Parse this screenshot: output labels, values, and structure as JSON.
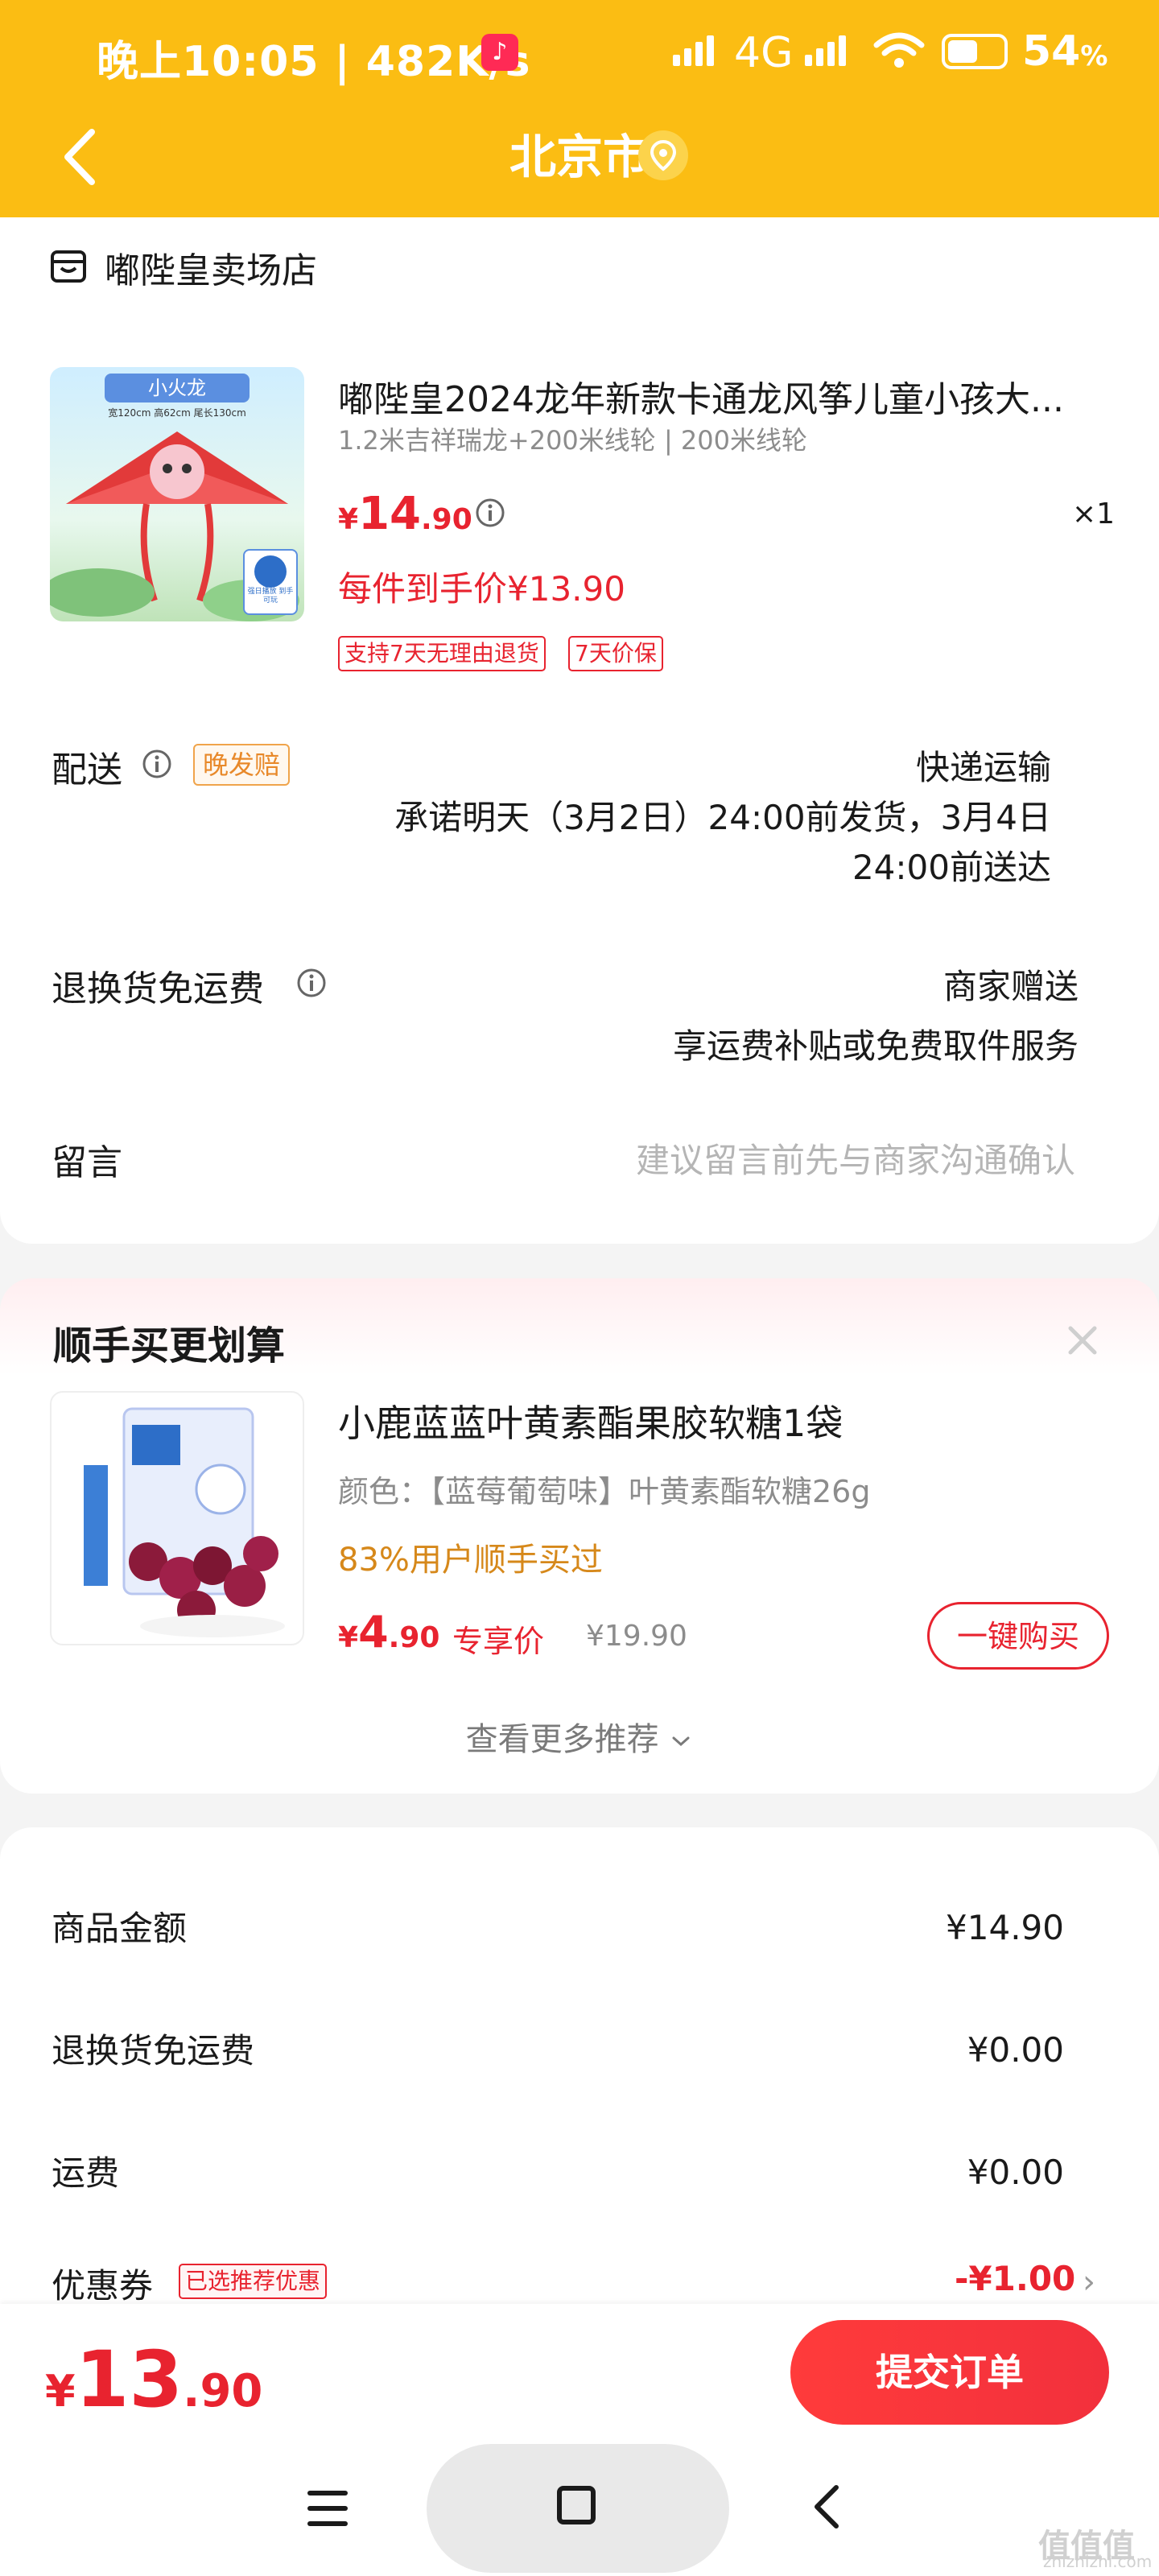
{
  "status_bar": {
    "time": "晚上10:05 | 482K/s",
    "network": "4G",
    "battery": "54",
    "battery_unit": "%"
  },
  "header": {
    "city": "北京市",
    "back_icon": "chevron-left-icon",
    "location_icon": "location-pin-icon"
  },
  "shop": {
    "name": "嘟陛皇卖场店",
    "icon": "shop-icon"
  },
  "product": {
    "title": "嘟陛皇2024龙年新款卡通龙风筝儿童小孩大...",
    "spec": "1.2米吉祥瑞龙+200米线轮 | 200米线轮",
    "currency": "¥",
    "price_int": "14",
    "price_dec": ".90",
    "qty": "×1",
    "per_price": "每件到手价¥13.90",
    "tags": [
      "支持7天无理由退货",
      "7天价保"
    ],
    "img_label": "小火龙",
    "img_dims": "宽120cm 高62cm 尾长130cm",
    "img_badge": "强日播放 到手可玩"
  },
  "delivery": {
    "label": "配送",
    "tag": "晚发赔",
    "method": "快递运输",
    "promise_1": "承诺明天（3月2日）24:00前发货，3月4日",
    "promise_2": "24:00前送达"
  },
  "return_shipping": {
    "label": "退换货免运费",
    "value": "商家赠送",
    "desc": "享运费补贴或免费取件服务"
  },
  "message": {
    "label": "留言",
    "placeholder": "建议留言前先与商家沟通确认"
  },
  "recommend": {
    "title": "顺手买更划算",
    "item_title": "小鹿蓝蓝叶黄素酯果胶软糖1袋",
    "item_spec": "颜色：【蓝莓葡萄味】叶黄素酯软糖26g",
    "item_pct": "83%用户顺手买过",
    "currency": "¥",
    "price_int": "4",
    "price_dec": ".90",
    "excl_label": "专享价",
    "orig_price": "¥19.90",
    "buy_button": "一键购买",
    "more": "查看更多推荐"
  },
  "summary": {
    "rows": [
      {
        "label": "商品金额",
        "value": "¥14.90"
      },
      {
        "label": "退换货免运费",
        "value": "¥0.00"
      },
      {
        "label": "运费",
        "value": "¥0.00"
      }
    ],
    "coupon_label": "优惠券",
    "coupon_tag": "已选推荐优惠",
    "coupon_value": "-¥1.00"
  },
  "checkout": {
    "currency": "¥",
    "total_int": "13",
    "total_dec": ".90",
    "submit": "提交订单"
  },
  "watermark": {
    "text": "值值值",
    "url": "zhizhizhi.com"
  },
  "colors": {
    "header": "#fbbd13",
    "accent": "#e8232f",
    "tag_orange": "#e8892a"
  }
}
